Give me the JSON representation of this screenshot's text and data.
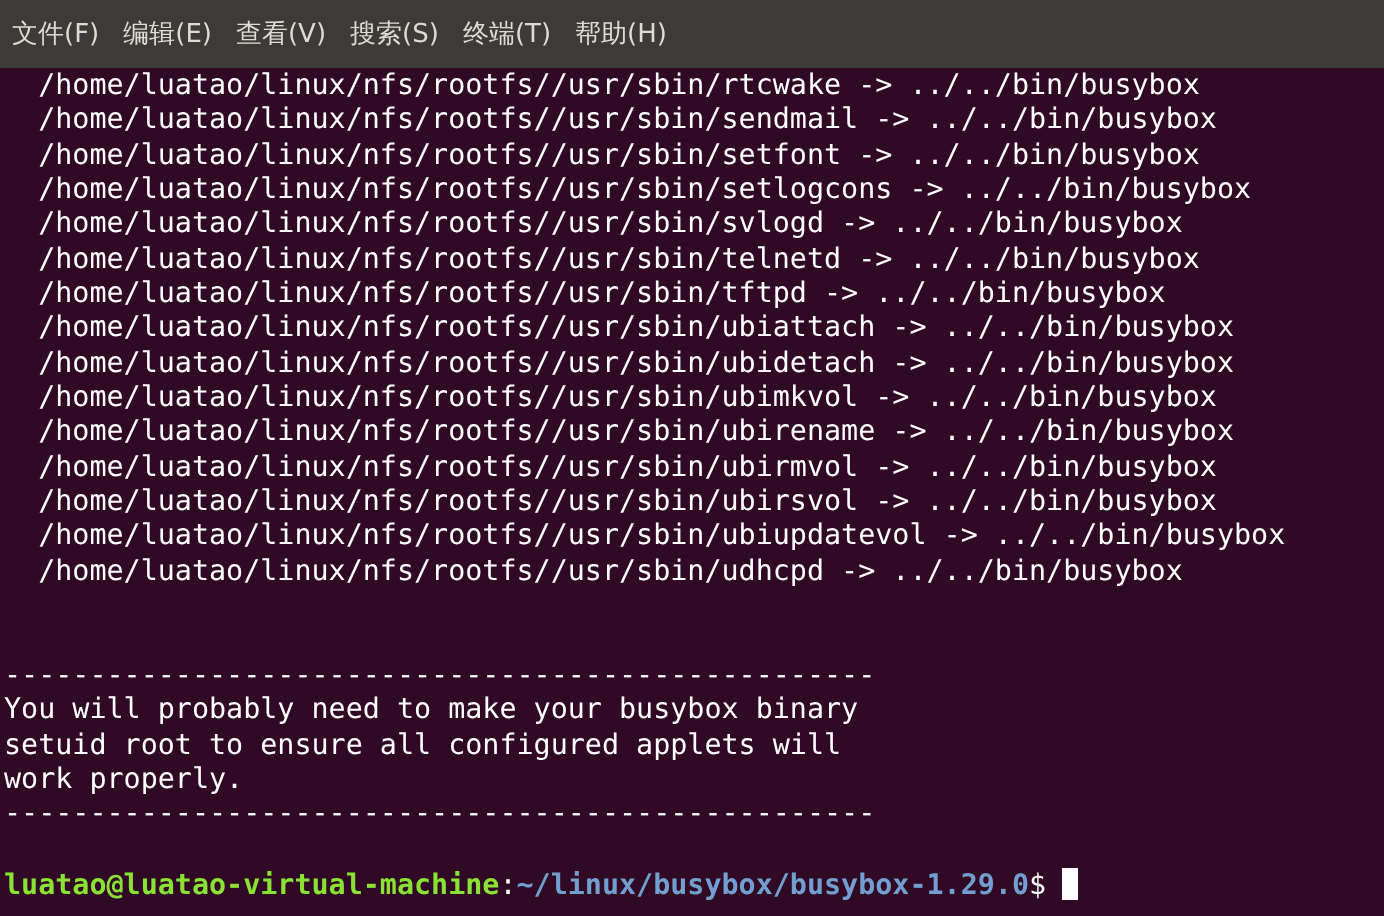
{
  "menu": [
    {
      "label": "文件(F)"
    },
    {
      "label": "编辑(E)"
    },
    {
      "label": "查看(V)"
    },
    {
      "label": "搜索(S)"
    },
    {
      "label": "终端(T)"
    },
    {
      "label": "帮助(H)"
    }
  ],
  "terminal": {
    "lines": [
      {
        "kind": "output",
        "text": "  /home/luatao/linux/nfs/rootfs//usr/sbin/rtcwake -> ../../bin/busybox"
      },
      {
        "kind": "output",
        "text": "  /home/luatao/linux/nfs/rootfs//usr/sbin/sendmail -> ../../bin/busybox"
      },
      {
        "kind": "output",
        "text": "  /home/luatao/linux/nfs/rootfs//usr/sbin/setfont -> ../../bin/busybox"
      },
      {
        "kind": "output",
        "text": "  /home/luatao/linux/nfs/rootfs//usr/sbin/setlogcons -> ../../bin/busybox"
      },
      {
        "kind": "output",
        "text": "  /home/luatao/linux/nfs/rootfs//usr/sbin/svlogd -> ../../bin/busybox"
      },
      {
        "kind": "output",
        "text": "  /home/luatao/linux/nfs/rootfs//usr/sbin/telnetd -> ../../bin/busybox"
      },
      {
        "kind": "output",
        "text": "  /home/luatao/linux/nfs/rootfs//usr/sbin/tftpd -> ../../bin/busybox"
      },
      {
        "kind": "output",
        "text": "  /home/luatao/linux/nfs/rootfs//usr/sbin/ubiattach -> ../../bin/busybox"
      },
      {
        "kind": "output",
        "text": "  /home/luatao/linux/nfs/rootfs//usr/sbin/ubidetach -> ../../bin/busybox"
      },
      {
        "kind": "output",
        "text": "  /home/luatao/linux/nfs/rootfs//usr/sbin/ubimkvol -> ../../bin/busybox"
      },
      {
        "kind": "output",
        "text": "  /home/luatao/linux/nfs/rootfs//usr/sbin/ubirename -> ../../bin/busybox"
      },
      {
        "kind": "output",
        "text": "  /home/luatao/linux/nfs/rootfs//usr/sbin/ubirmvol -> ../../bin/busybox"
      },
      {
        "kind": "output",
        "text": "  /home/luatao/linux/nfs/rootfs//usr/sbin/ubirsvol -> ../../bin/busybox"
      },
      {
        "kind": "output",
        "text": "  /home/luatao/linux/nfs/rootfs//usr/sbin/ubiupdatevol -> ../../bin/busybox"
      },
      {
        "kind": "output",
        "text": "  /home/luatao/linux/nfs/rootfs//usr/sbin/udhcpd -> ../../bin/busybox"
      },
      {
        "kind": "blank"
      },
      {
        "kind": "blank"
      },
      {
        "kind": "output",
        "text": "---------------------------------------------------"
      },
      {
        "kind": "output",
        "text": "You will probably need to make your busybox binary"
      },
      {
        "kind": "output",
        "text": "setuid root to ensure all configured applets will"
      },
      {
        "kind": "output",
        "text": "work properly."
      },
      {
        "kind": "output",
        "text": "---------------------------------------------------"
      },
      {
        "kind": "blank"
      },
      {
        "kind": "prompt",
        "user_host": "luatao@luatao-virtual-machine",
        "separator": ":",
        "path": "~/linux/busybox/busybox-1.29.0",
        "symbol": "$",
        "cursor": true
      }
    ]
  }
}
